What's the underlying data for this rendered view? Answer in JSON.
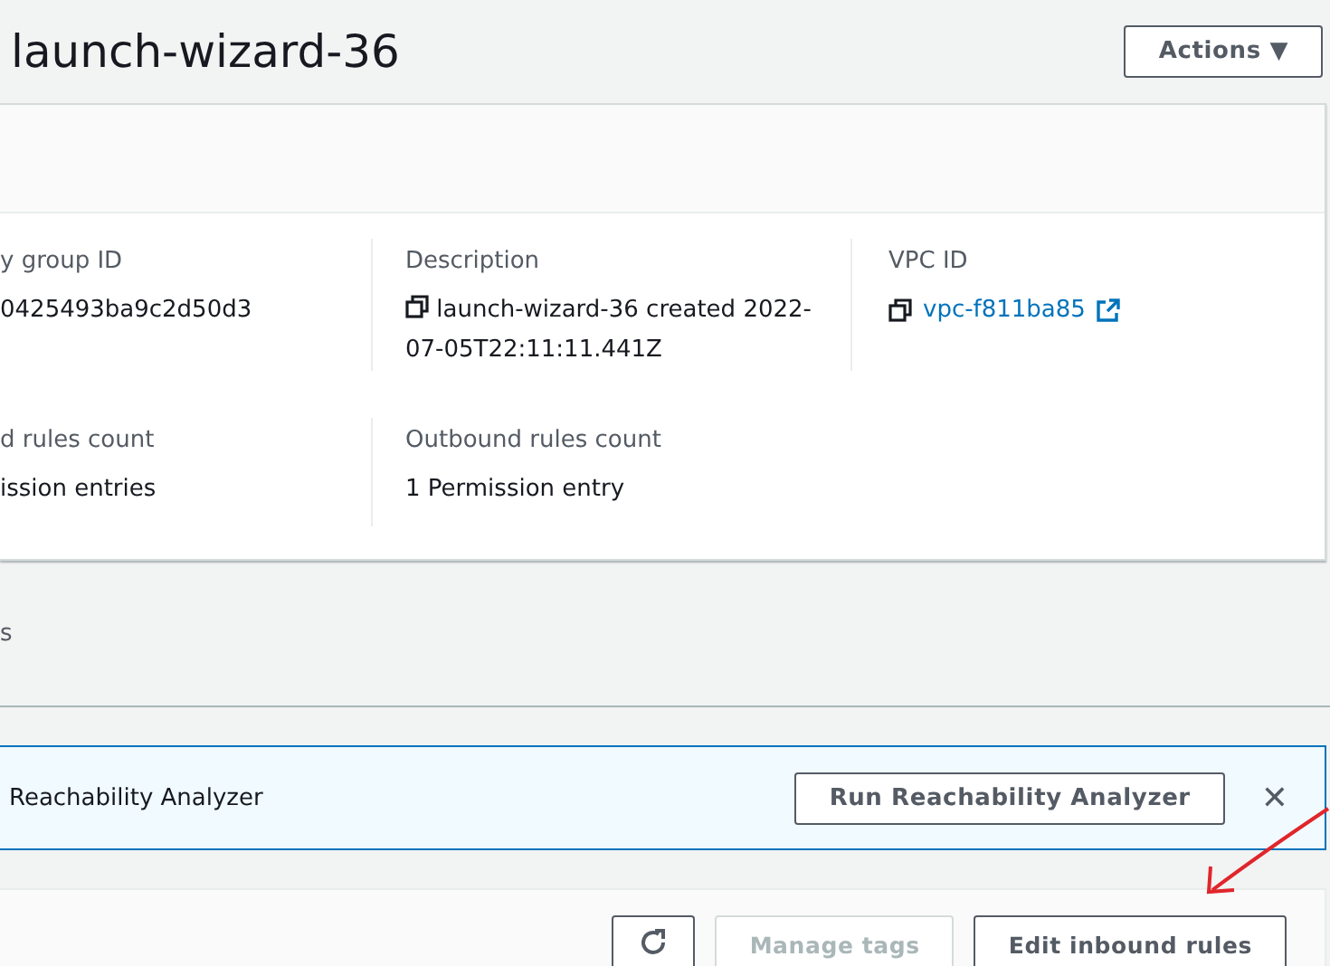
{
  "header": {
    "title": "launch-wizard-36",
    "actions_button": "Actions ▼"
  },
  "details": {
    "fields": [
      {
        "label": "y group ID",
        "value": "0425493ba9c2d50d3",
        "kind": "text"
      },
      {
        "label": "Description",
        "value": "launch-wizard-36 created 2022-07-05T22:11:11.441Z",
        "kind": "copy"
      },
      {
        "label": "VPC ID",
        "value": "vpc-f811ba85",
        "kind": "link"
      },
      {
        "label": "d rules count",
        "value": "ission entries",
        "kind": "text"
      },
      {
        "label": "Outbound rules count",
        "value": "1 Permission entry",
        "kind": "text"
      }
    ]
  },
  "tabs": [
    {
      "label": "s",
      "selected": false
    }
  ],
  "banner": {
    "text": "Reachability Analyzer",
    "button": "Run Reachability Analyzer",
    "close": "✕"
  },
  "toolbar": {
    "buttons": [
      {
        "kind": "refresh",
        "disabled": false
      },
      {
        "kind": "text",
        "label": "Manage tags",
        "disabled": true
      },
      {
        "kind": "text",
        "label": "Edit inbound rules",
        "disabled": false
      }
    ]
  }
}
